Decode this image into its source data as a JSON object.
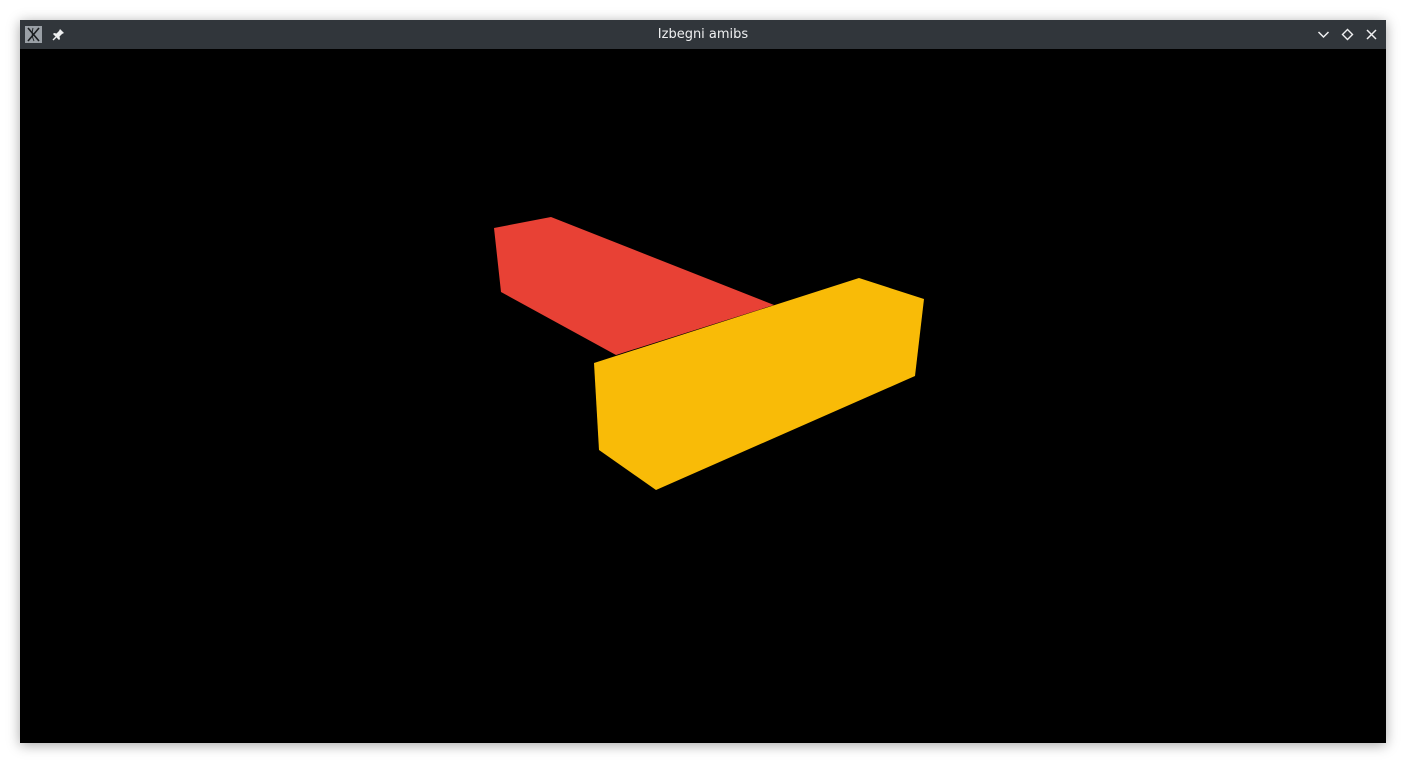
{
  "window": {
    "title": "Izbegni amibs"
  },
  "titlebar_buttons": {
    "app_icon": "x11-app-icon",
    "pin": "pin-icon",
    "minimize": "chevron-down-icon",
    "maximize": "diamond-icon",
    "close": "close-icon"
  },
  "scene": {
    "background_color": "#000000",
    "objects": [
      {
        "name": "red-block",
        "color": "#e84135"
      },
      {
        "name": "yellow-block",
        "color": "#f9bb07"
      }
    ]
  }
}
